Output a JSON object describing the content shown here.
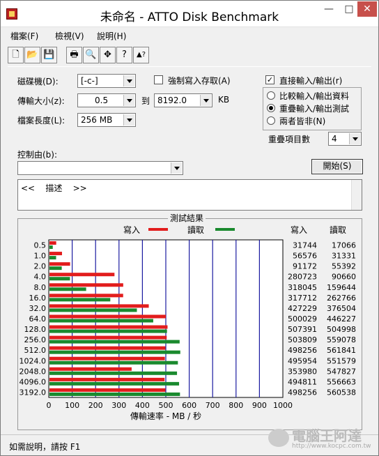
{
  "window": {
    "title": "未命名 - ATTO Disk Benchmark"
  },
  "titlebar_buttons": {
    "minimize": "—",
    "maximize": "□",
    "close": "✕"
  },
  "menu": [
    "檔案(F)",
    "檢視(V)",
    "說明(H)"
  ],
  "toolbar": {
    "icons": [
      "new-file-icon",
      "open-folder-icon",
      "save-icon",
      "print-icon",
      "print-preview-icon",
      "move-icon",
      "help-icon",
      "context-help-icon"
    ],
    "glyphs": [
      "🗋",
      "📂",
      "💾",
      "🖶",
      "🔍",
      "✥",
      "?",
      "▲?"
    ]
  },
  "settings": {
    "drive_label": "磁碟機(D):",
    "drive_value": "[-c-]",
    "force_write_label": "強制寫入存取(A)",
    "force_write_checked": false,
    "direct_io_label": "直接輸入/輸出(r)",
    "direct_io_checked": true,
    "transfer_size_label": "傳輸大小(z):",
    "transfer_from": "0.5",
    "to_label": "到",
    "transfer_to": "8192.0",
    "kb_label": "KB",
    "file_length_label": "檔案長度(L):",
    "file_length_value": "256 MB",
    "radio_options": [
      {
        "label": "比較輸入/輸出資料",
        "checked": false
      },
      {
        "label": "重疊輸入/輸出測試",
        "checked": true
      },
      {
        "label": "兩者皆非(N)",
        "checked": false
      }
    ],
    "queue_depth_label": "重疊項目數",
    "queue_depth_value": "4",
    "controlled_by_label": "控制由(b):",
    "controlled_by_value": "",
    "start_button": "開始(S)",
    "description_text": "<<    描述    >>"
  },
  "results": {
    "title": "測試結果",
    "write_legend": "寫入",
    "read_legend": "讀取",
    "write_header": "寫入",
    "read_header": "讀取",
    "colors": {
      "write": "#e21d1d",
      "read": "#1a8a2e",
      "grid": "#1a1aa0"
    }
  },
  "chart_data": {
    "type": "bar",
    "orientation": "horizontal",
    "categories": [
      "0.5",
      "1.0",
      "2.0",
      "4.0",
      "8.0",
      "16.0",
      "32.0",
      "64.0",
      "128.0",
      "256.0",
      "512.0",
      "1024.0",
      "2048.0",
      "4096.0",
      "3192.0"
    ],
    "series": [
      {
        "name": "寫入",
        "values": [
          31744,
          56576,
          91172,
          280723,
          318045,
          317712,
          427229,
          500029,
          507391,
          503809,
          498256,
          495954,
          353980,
          494811,
          498256
        ]
      },
      {
        "name": "讀取",
        "values": [
          17066,
          31331,
          55392,
          90660,
          159644,
          262766,
          376504,
          446227,
          504998,
          559078,
          561841,
          551579,
          547827,
          556663,
          560538
        ]
      }
    ],
    "xlabel": "傳輸速率 - MB / 秒",
    "xlim": [
      0,
      1000
    ],
    "xticks": [
      0,
      100,
      200,
      300,
      400,
      500,
      600,
      700,
      800,
      900,
      1000
    ],
    "grid": true,
    "legend": "top"
  },
  "statusbar": {
    "text": "如需說明，請按 F1"
  },
  "watermark": {
    "name": "電腦王阿達",
    "url": "http://www.kocpc.com.tw"
  }
}
